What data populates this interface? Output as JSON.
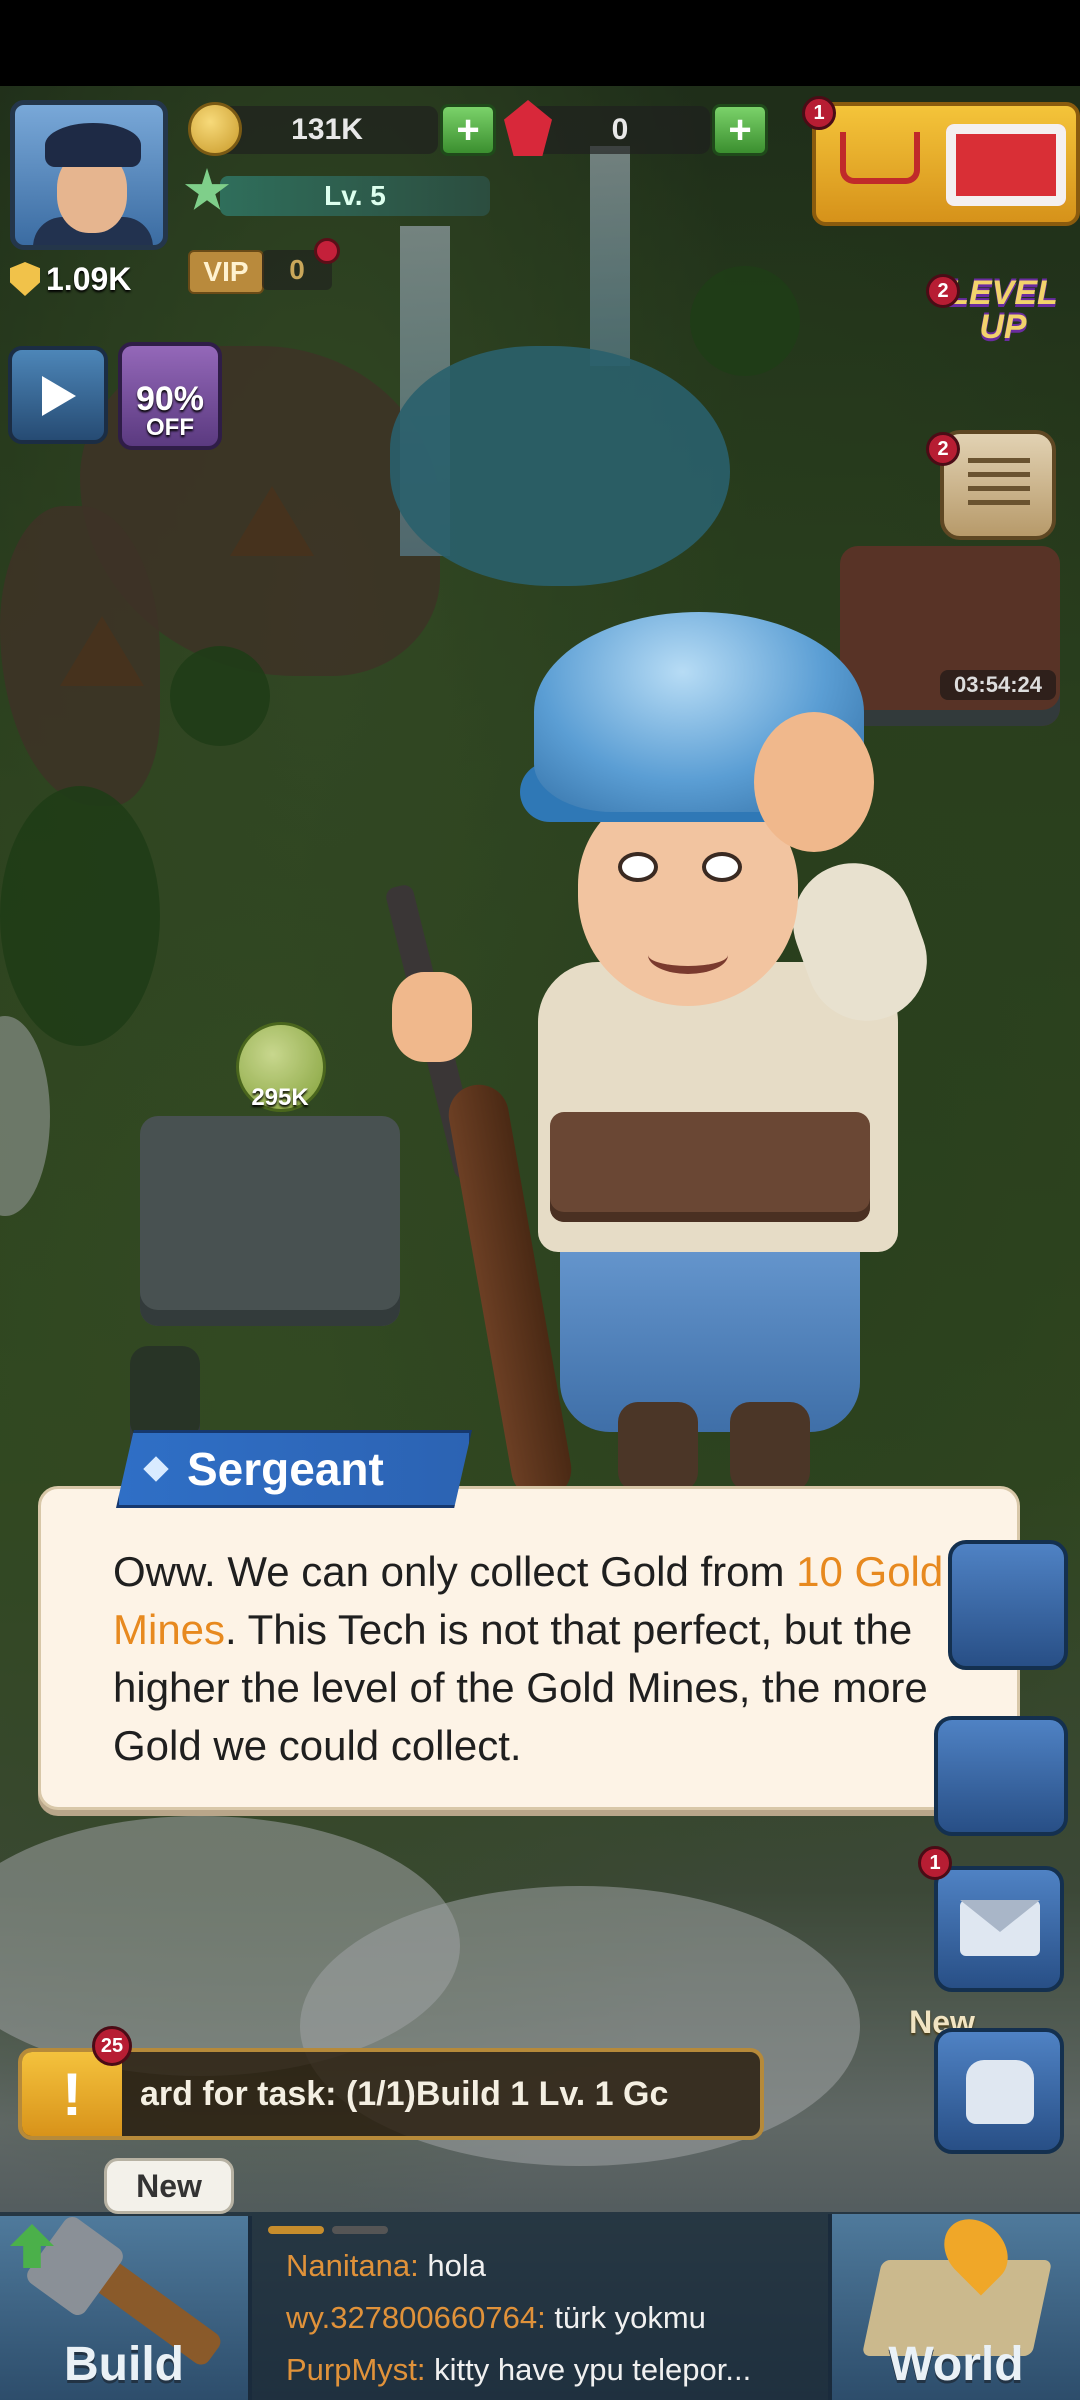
{
  "hud": {
    "power": "1.09K",
    "gold": "131K",
    "gems": "0",
    "level": "Lv. 5",
    "vip_label": "VIP",
    "vip_level": "0",
    "shop_badge": "1",
    "levelup_badge": "2",
    "levelup_line1": "LEVEL",
    "levelup_line2": "UP",
    "quest_badge": "2",
    "timer": "03:54:24",
    "discount_pct": "90%",
    "discount_off": "OFF",
    "gold_mine_amount": "295K"
  },
  "dialog": {
    "speaker": "Sergeant",
    "text_before": "Oww. We can only collect Gold from ",
    "highlight": "10 Gold Mines",
    "text_after": ". This Tech is not that perfect, but the higher the level of the Gold Mines, the more Gold we could collect."
  },
  "side": {
    "mail_badge": "1",
    "new_label": "New"
  },
  "task": {
    "badge": "25",
    "alert": "!",
    "text": "ard for task: (1/1)Build 1 Lv. 1 Gc"
  },
  "bottom": {
    "build_label": "Build",
    "build_new": "New",
    "world_label": "World",
    "chat": [
      {
        "user": "Nanitana:",
        "msg": " hola"
      },
      {
        "user": "wy.327800660764:",
        "msg": " türk yokmu"
      },
      {
        "user": "PurpMyst:",
        "msg": " kitty have ypu telepor..."
      }
    ]
  },
  "colors": {
    "highlight": "#e7891f",
    "speaker_tag": "#2f6fc6",
    "dialog_bg": "#fdf3e6"
  }
}
